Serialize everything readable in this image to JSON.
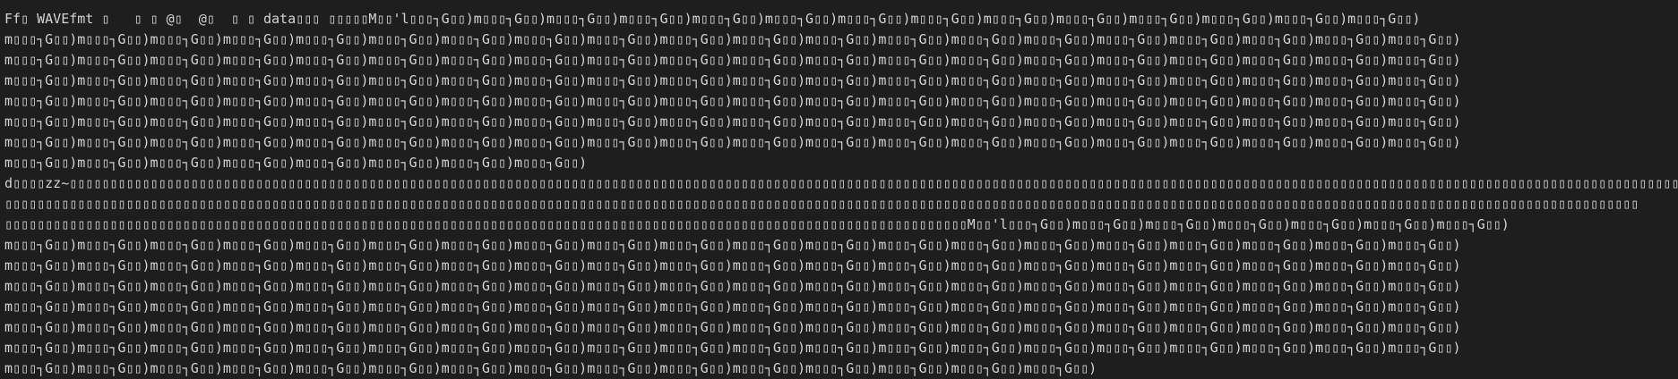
{
  "colors": {
    "background": "#1e1e1e",
    "text": "#d4d4d4"
  },
  "lines": [
    "Ff▯ WAVEfmt ▯   ▯ ▯ @▯  @▯  ▯ ▯ data▯▯▯ ▯▯▯▯▯M▯▯'l▯▯▯┐G▯▯)m▯▯▯┐G▯▯)m▯▯▯┐G▯▯)m▯▯▯┐G▯▯)m▯▯▯┐G▯▯)m▯▯▯┐G▯▯)m▯▯▯┐G▯▯)m▯▯▯┐G▯▯)m▯▯▯┐G▯▯)m▯▯▯┐G▯▯)m▯▯▯┐G▯▯)m▯▯▯┐G▯▯)m▯▯▯┐G▯▯)m▯▯▯┐G▯▯)",
    "m▯▯▯┐G▯▯)m▯▯▯┐G▯▯)m▯▯▯┐G▯▯)m▯▯▯┐G▯▯)m▯▯▯┐G▯▯)m▯▯▯┐G▯▯)m▯▯▯┐G▯▯)m▯▯▯┐G▯▯)m▯▯▯┐G▯▯)m▯▯▯┐G▯▯)m▯▯▯┐G▯▯)m▯▯▯┐G▯▯)m▯▯▯┐G▯▯)m▯▯▯┐G▯▯)m▯▯▯┐G▯▯)m▯▯▯┐G▯▯)m▯▯▯┐G▯▯)m▯▯▯┐G▯▯)m▯▯▯┐G▯▯)m▯▯▯┐G▯▯)",
    "m▯▯▯┐G▯▯)m▯▯▯┐G▯▯)m▯▯▯┐G▯▯)m▯▯▯┐G▯▯)m▯▯▯┐G▯▯)m▯▯▯┐G▯▯)m▯▯▯┐G▯▯)m▯▯▯┐G▯▯)m▯▯▯┐G▯▯)m▯▯▯┐G▯▯)m▯▯▯┐G▯▯)m▯▯▯┐G▯▯)m▯▯▯┐G▯▯)m▯▯▯┐G▯▯)m▯▯▯┐G▯▯)m▯▯▯┐G▯▯)m▯▯▯┐G▯▯)m▯▯▯┐G▯▯)m▯▯▯┐G▯▯)m▯▯▯┐G▯▯)",
    "m▯▯▯┐G▯▯)m▯▯▯┐G▯▯)m▯▯▯┐G▯▯)m▯▯▯┐G▯▯)m▯▯▯┐G▯▯)m▯▯▯┐G▯▯)m▯▯▯┐G▯▯)m▯▯▯┐G▯▯)m▯▯▯┐G▯▯)m▯▯▯┐G▯▯)m▯▯▯┐G▯▯)m▯▯▯┐G▯▯)m▯▯▯┐G▯▯)m▯▯▯┐G▯▯)m▯▯▯┐G▯▯)m▯▯▯┐G▯▯)m▯▯▯┐G▯▯)m▯▯▯┐G▯▯)m▯▯▯┐G▯▯)m▯▯▯┐G▯▯)",
    "m▯▯▯┐G▯▯)m▯▯▯┐G▯▯)m▯▯▯┐G▯▯)m▯▯▯┐G▯▯)m▯▯▯┐G▯▯)m▯▯▯┐G▯▯)m▯▯▯┐G▯▯)m▯▯▯┐G▯▯)m▯▯▯┐G▯▯)m▯▯▯┐G▯▯)m▯▯▯┐G▯▯)m▯▯▯┐G▯▯)m▯▯▯┐G▯▯)m▯▯▯┐G▯▯)m▯▯▯┐G▯▯)m▯▯▯┐G▯▯)m▯▯▯┐G▯▯)m▯▯▯┐G▯▯)m▯▯▯┐G▯▯)m▯▯▯┐G▯▯)",
    "m▯▯▯┐G▯▯)m▯▯▯┐G▯▯)m▯▯▯┐G▯▯)m▯▯▯┐G▯▯)m▯▯▯┐G▯▯)m▯▯▯┐G▯▯)m▯▯▯┐G▯▯)m▯▯▯┐G▯▯)m▯▯▯┐G▯▯)m▯▯▯┐G▯▯)m▯▯▯┐G▯▯)m▯▯▯┐G▯▯)m▯▯▯┐G▯▯)m▯▯▯┐G▯▯)m▯▯▯┐G▯▯)m▯▯▯┐G▯▯)m▯▯▯┐G▯▯)m▯▯▯┐G▯▯)m▯▯▯┐G▯▯)m▯▯▯┐G▯▯)",
    "m▯▯▯┐G▯▯)m▯▯▯┐G▯▯)m▯▯▯┐G▯▯)m▯▯▯┐G▯▯)m▯▯▯┐G▯▯)m▯▯▯┐G▯▯)m▯▯▯┐G▯▯)m▯▯▯┐G▯▯)m▯▯▯┐G▯▯)m▯▯▯┐G▯▯)m▯▯▯┐G▯▯)m▯▯▯┐G▯▯)m▯▯▯┐G▯▯)m▯▯▯┐G▯▯)m▯▯▯┐G▯▯)m▯▯▯┐G▯▯)m▯▯▯┐G▯▯)m▯▯▯┐G▯▯)m▯▯▯┐G▯▯)m▯▯▯┐G▯▯)",
    "m▯▯▯┐G▯▯)m▯▯▯┐G▯▯)m▯▯▯┐G▯▯)m▯▯▯┐G▯▯)m▯▯▯┐G▯▯)m▯▯▯┐G▯▯)m▯▯▯┐G▯▯)m▯▯▯┐G▯▯)",
    "d▯▯▯▯zz~▯▯▯▯▯▯▯▯▯▯▯▯▯▯▯▯▯▯▯▯▯▯▯▯▯▯▯▯▯▯▯▯▯▯▯▯▯▯▯▯▯▯▯▯▯▯▯▯▯▯▯▯▯▯▯▯▯▯▯▯▯▯▯▯▯▯▯▯▯▯▯▯▯▯▯▯▯▯▯▯▯▯▯▯▯▯▯▯▯▯▯▯▯▯▯▯▯▯▯▯▯▯▯▯▯▯▯▯▯▯▯▯▯▯▯▯▯▯▯▯▯▯▯▯▯▯▯▯▯▯▯▯▯▯▯▯▯▯▯▯▯▯▯▯▯▯▯▯▯▯▯▯▯▯▯▯▯▯▯▯▯▯▯▯▯▯▯▯▯▯▯▯▯▯▯▯▯▯▯▯▯▯▯▯▯▯▯▯▯▯▯▯▯▯▯▯▯▯▯▯",
    "▯▯▯▯▯▯▯▯▯▯▯▯▯▯▯▯▯▯▯▯▯▯▯▯▯▯▯▯▯▯▯▯▯▯▯▯▯▯▯▯▯▯▯▯▯▯▯▯▯▯▯▯▯▯▯▯▯▯▯▯▯▯▯▯▯▯▯▯▯▯▯▯▯▯▯▯▯▯▯▯▯▯▯▯▯▯▯▯▯▯▯▯▯▯▯▯▯▯▯▯▯▯▯▯▯▯▯▯▯▯▯▯▯▯▯▯▯▯▯▯▯▯▯▯▯▯▯▯▯▯▯▯▯▯▯▯▯▯▯▯▯▯▯▯▯▯▯▯▯▯▯▯▯▯▯▯▯▯▯▯▯▯▯▯▯▯▯▯▯▯▯▯▯▯▯▯▯▯▯▯▯▯▯▯▯▯▯▯▯▯▯▯▯▯▯▯▯▯▯▯▯▯",
    "▯▯▯▯▯▯▯▯▯▯▯▯▯▯▯▯▯▯▯▯▯▯▯▯▯▯▯▯▯▯▯▯▯▯▯▯▯▯▯▯▯▯▯▯▯▯▯▯▯▯▯▯▯▯▯▯▯▯▯▯▯▯▯▯▯▯▯▯▯▯▯▯▯▯▯▯▯▯▯▯▯▯▯▯▯▯▯▯▯▯▯▯▯▯▯▯▯▯▯▯▯▯▯▯▯▯▯▯▯▯▯▯▯▯▯▯▯▯▯M▯▯'l▯▯▯┐G▯▯)m▯▯▯┐G▯▯)m▯▯▯┐G▯▯)m▯▯▯┐G▯▯)m▯▯▯┐G▯▯)m▯▯▯┐G▯▯)m▯▯▯┐G▯▯)",
    "m▯▯▯┐G▯▯)m▯▯▯┐G▯▯)m▯▯▯┐G▯▯)m▯▯▯┐G▯▯)m▯▯▯┐G▯▯)m▯▯▯┐G▯▯)m▯▯▯┐G▯▯)m▯▯▯┐G▯▯)m▯▯▯┐G▯▯)m▯▯▯┐G▯▯)m▯▯▯┐G▯▯)m▯▯▯┐G▯▯)m▯▯▯┐G▯▯)m▯▯▯┐G▯▯)m▯▯▯┐G▯▯)m▯▯▯┐G▯▯)m▯▯▯┐G▯▯)m▯▯▯┐G▯▯)m▯▯▯┐G▯▯)m▯▯▯┐G▯▯)",
    "m▯▯▯┐G▯▯)m▯▯▯┐G▯▯)m▯▯▯┐G▯▯)m▯▯▯┐G▯▯)m▯▯▯┐G▯▯)m▯▯▯┐G▯▯)m▯▯▯┐G▯▯)m▯▯▯┐G▯▯)m▯▯▯┐G▯▯)m▯▯▯┐G▯▯)m▯▯▯┐G▯▯)m▯▯▯┐G▯▯)m▯▯▯┐G▯▯)m▯▯▯┐G▯▯)m▯▯▯┐G▯▯)m▯▯▯┐G▯▯)m▯▯▯┐G▯▯)m▯▯▯┐G▯▯)m▯▯▯┐G▯▯)m▯▯▯┐G▯▯)",
    "m▯▯▯┐G▯▯)m▯▯▯┐G▯▯)m▯▯▯┐G▯▯)m▯▯▯┐G▯▯)m▯▯▯┐G▯▯)m▯▯▯┐G▯▯)m▯▯▯┐G▯▯)m▯▯▯┐G▯▯)m▯▯▯┐G▯▯)m▯▯▯┐G▯▯)m▯▯▯┐G▯▯)m▯▯▯┐G▯▯)m▯▯▯┐G▯▯)m▯▯▯┐G▯▯)m▯▯▯┐G▯▯)m▯▯▯┐G▯▯)m▯▯▯┐G▯▯)m▯▯▯┐G▯▯)m▯▯▯┐G▯▯)m▯▯▯┐G▯▯)",
    "m▯▯▯┐G▯▯)m▯▯▯┐G▯▯)m▯▯▯┐G▯▯)m▯▯▯┐G▯▯)m▯▯▯┐G▯▯)m▯▯▯┐G▯▯)m▯▯▯┐G▯▯)m▯▯▯┐G▯▯)m▯▯▯┐G▯▯)m▯▯▯┐G▯▯)m▯▯▯┐G▯▯)m▯▯▯┐G▯▯)m▯▯▯┐G▯▯)m▯▯▯┐G▯▯)m▯▯▯┐G▯▯)m▯▯▯┐G▯▯)m▯▯▯┐G▯▯)m▯▯▯┐G▯▯)m▯▯▯┐G▯▯)m▯▯▯┐G▯▯)",
    "m▯▯▯┐G▯▯)m▯▯▯┐G▯▯)m▯▯▯┐G▯▯)m▯▯▯┐G▯▯)m▯▯▯┐G▯▯)m▯▯▯┐G▯▯)m▯▯▯┐G▯▯)m▯▯▯┐G▯▯)m▯▯▯┐G▯▯)m▯▯▯┐G▯▯)m▯▯▯┐G▯▯)m▯▯▯┐G▯▯)m▯▯▯┐G▯▯)m▯▯▯┐G▯▯)m▯▯▯┐G▯▯)m▯▯▯┐G▯▯)m▯▯▯┐G▯▯)m▯▯▯┐G▯▯)m▯▯▯┐G▯▯)m▯▯▯┐G▯▯)",
    "m▯▯▯┐G▯▯)m▯▯▯┐G▯▯)m▯▯▯┐G▯▯)m▯▯▯┐G▯▯)m▯▯▯┐G▯▯)m▯▯▯┐G▯▯)m▯▯▯┐G▯▯)m▯▯▯┐G▯▯)m▯▯▯┐G▯▯)m▯▯▯┐G▯▯)m▯▯▯┐G▯▯)m▯▯▯┐G▯▯)m▯▯▯┐G▯▯)m▯▯▯┐G▯▯)m▯▯▯┐G▯▯)m▯▯▯┐G▯▯)m▯▯▯┐G▯▯)m▯▯▯┐G▯▯)m▯▯▯┐G▯▯)m▯▯▯┐G▯▯)",
    "m▯▯▯┐G▯▯)m▯▯▯┐G▯▯)m▯▯▯┐G▯▯)m▯▯▯┐G▯▯)m▯▯▯┐G▯▯)m▯▯▯┐G▯▯)m▯▯▯┐G▯▯)m▯▯▯┐G▯▯)m▯▯▯┐G▯▯)m▯▯▯┐G▯▯)m▯▯▯┐G▯▯)m▯▯▯┐G▯▯)m▯▯▯┐G▯▯)m▯▯▯┐G▯▯)m▯▯▯┐G▯▯)"
  ]
}
